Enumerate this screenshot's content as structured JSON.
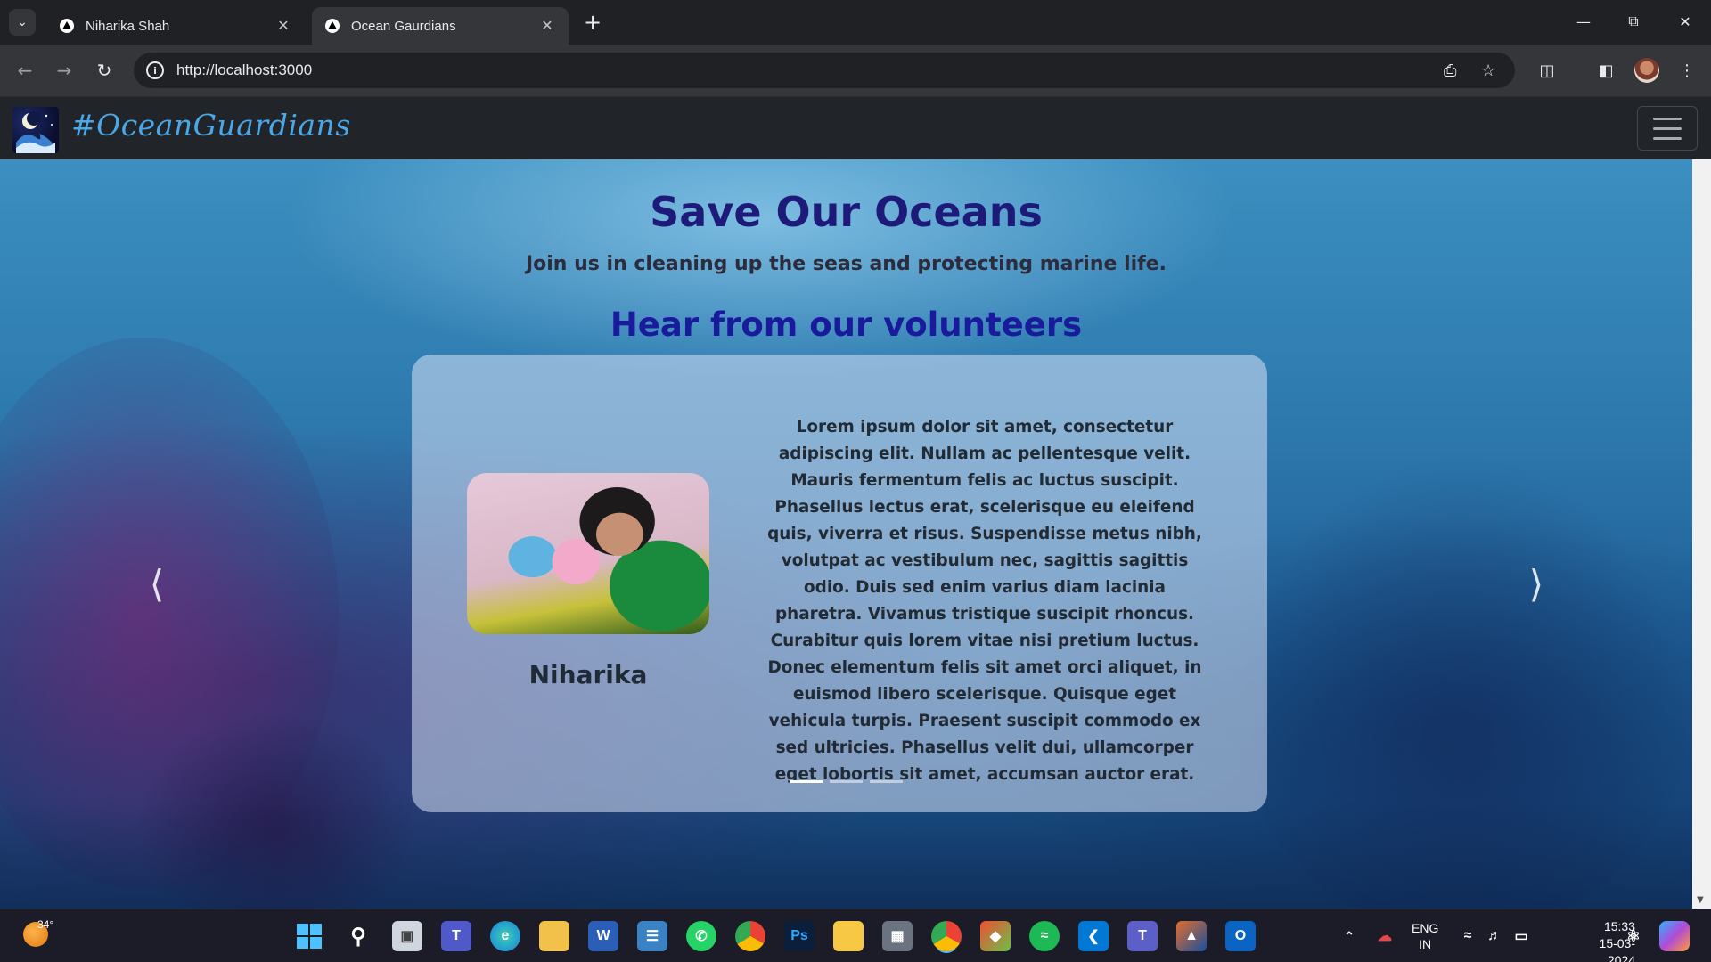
{
  "browser": {
    "tabs": [
      {
        "title": "Niharika Shah",
        "active": false
      },
      {
        "title": "Ocean Gaurdians",
        "active": true
      }
    ],
    "url": "http://localhost:3000"
  },
  "site": {
    "brand": "#OceanGuardians",
    "hero": {
      "title": "Save Our Oceans",
      "subtitle": "Join us in cleaning up the seas and protecting marine life."
    },
    "testimonials": {
      "heading": "Hear from our volunteers",
      "active_index": 0,
      "slide_count": 3,
      "current": {
        "name": "Niharika",
        "quote": "Lorem ipsum dolor sit amet, consectetur adipiscing elit. Nullam ac pellentesque velit. Mauris fermentum felis ac luctus suscipit. Phasellus lectus erat, scelerisque eu eleifend quis, viverra et risus. Suspendisse metus nibh, volutpat ac vestibulum nec, sagittis sagittis odio. Duis sed enim varius diam lacinia pharetra. Vivamus tristique suscipit rhoncus. Curabitur quis lorem vitae nisi pretium luctus. Donec elementum felis sit amet orci aliquet, in euismod libero scelerisque. Quisque eget vehicula turpis. Praesent suscipit commodo ex sed ultricies. Phasellus velit dui, ullamcorper eget lobortis sit amet, accumsan auctor erat."
      }
    }
  },
  "taskbar": {
    "weather_temp": "34°",
    "lang_line1": "ENG",
    "lang_line2": "IN",
    "time": "15:33",
    "date": "15-03-2024"
  },
  "colors": {
    "brand": "#4aa8e8",
    "hero_title": "#1e1a7a",
    "section_title": "#1a1a9c"
  }
}
